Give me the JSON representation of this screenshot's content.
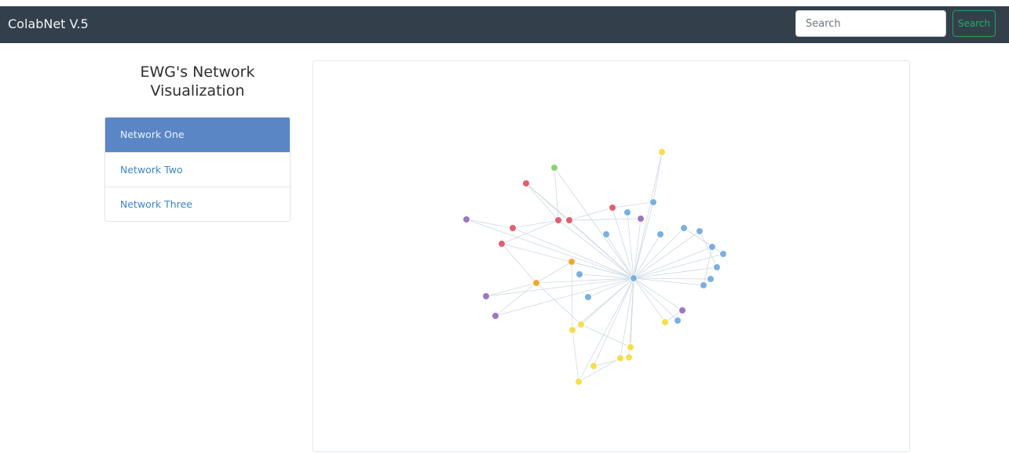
{
  "navbar": {
    "brand": "ColabNet V.5",
    "search": {
      "placeholder": "Search",
      "value": "",
      "button_label": "Search"
    }
  },
  "sidebar": {
    "title": "EWG's Network Visualization",
    "items": [
      {
        "label": "Network One",
        "active": true
      },
      {
        "label": "Network Two",
        "active": false
      },
      {
        "label": "Network Three",
        "active": false
      }
    ]
  },
  "colors": {
    "navbar_bg": "#343f4c",
    "active_item": "#5b86c5",
    "link": "#3d86c6",
    "search_button": "#22b35f",
    "node_red": "#e06070",
    "node_blue": "#7ab0e0",
    "node_yellow": "#f5df4a",
    "node_orange": "#f0a830",
    "node_purple": "#9a78c2",
    "node_green": "#8fd07a"
  }
}
